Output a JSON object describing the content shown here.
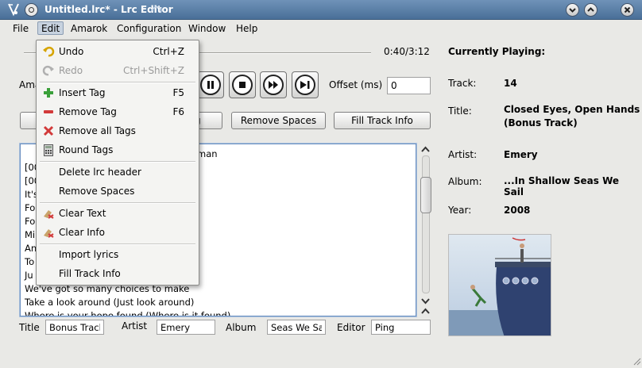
{
  "window": {
    "title": "Untitled.lrc* - Lrc Editor"
  },
  "menubar": [
    "File",
    "Edit",
    "Amarok",
    "Configuration",
    "Window",
    "Help"
  ],
  "player": {
    "time": "0:40/3:12",
    "progress": 0.21,
    "amarok_label_partial": "Ama",
    "offset_label": "Offset (ms)",
    "offset_value": "0"
  },
  "buttons": {
    "partial_left": "",
    "partial_middle": "g",
    "remove_spaces": "Remove Spaces",
    "fill_track_info": "Fill Track Info"
  },
  "edit_menu": {
    "items": [
      {
        "label": "Undo",
        "shortcut": "Ctrl+Z",
        "icon": "undo-icon",
        "enabled": true
      },
      {
        "label": "Redo",
        "shortcut": "Ctrl+Shift+Z",
        "icon": "redo-icon",
        "enabled": false
      },
      {
        "label": "Insert Tag",
        "shortcut": "F5",
        "icon": "plus-icon",
        "enabled": true
      },
      {
        "label": "Remove Tag",
        "shortcut": "F6",
        "icon": "minus-icon",
        "enabled": true
      },
      {
        "label": "Remove all Tags",
        "shortcut": "",
        "icon": "remove-all-icon",
        "enabled": true
      },
      {
        "label": "Round Tags",
        "shortcut": "",
        "icon": "calculator-icon",
        "enabled": true
      },
      {
        "label": "Delete lrc header",
        "shortcut": "",
        "icon": "",
        "enabled": true
      },
      {
        "label": "Remove Spaces",
        "shortcut": "",
        "icon": "",
        "enabled": true
      },
      {
        "label": "Clear Text",
        "shortcut": "",
        "icon": "eraser-icon",
        "enabled": true
      },
      {
        "label": "Clear Info",
        "shortcut": "",
        "icon": "eraser-icon",
        "enabled": true
      },
      {
        "label": "Import lyrics",
        "shortcut": "",
        "icon": "",
        "enabled": true
      },
      {
        "label": "Fill Track Info",
        "shortcut": "",
        "icon": "",
        "enabled": true
      }
    ]
  },
  "editor": {
    "lines": [
      "man",
      "[00",
      "[00",
      "It's",
      "Fo",
      "Fo",
      "Mi",
      "An",
      "To",
      "Ju",
      "We've got so many choices to make",
      "Take a look around (Just look around)",
      "Where is your hope found (Where is it found)"
    ]
  },
  "bottom": {
    "title_label": "Title",
    "title_value": "Bonus Track)",
    "artist_label": "Artist",
    "artist_value": "Emery",
    "album_label": "Album",
    "album_value": "Seas We Sail",
    "editor_label": "Editor",
    "editor_value": "Ping"
  },
  "info": {
    "heading": "Currently Playing:",
    "track_label": "Track:",
    "track_value": "14",
    "title_label": "Title:",
    "title_value_line1": "Closed Eyes, Open Hands",
    "title_value_line2": "(Bonus Track)",
    "artist_label": "Artist:",
    "artist_value": "Emery",
    "album_label": "Album:",
    "album_value": "...In Shallow Seas We Sail",
    "year_label": "Year:",
    "year_value": "2008"
  },
  "colors": {
    "titlebar": "#5a7fa8",
    "menu_highlight": "#c7d2df",
    "editor_border": "#6a8fc0"
  }
}
